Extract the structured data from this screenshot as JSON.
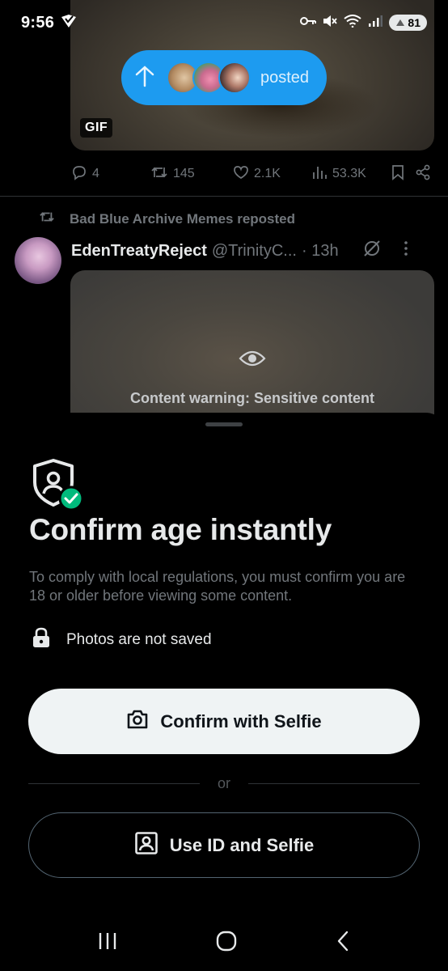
{
  "status_bar": {
    "time": "9:56",
    "battery": "81",
    "icons": [
      "location-check-icon",
      "key-icon",
      "mute-icon",
      "wifi-icon",
      "signal-icon",
      "battery-icon"
    ]
  },
  "previous_post": {
    "media_badge": "GIF",
    "new_posts_pill": {
      "label": "posted",
      "icon": "arrow-up-icon"
    },
    "actions": {
      "replies": "4",
      "reposts": "145",
      "likes": "2.1K",
      "views": "53.3K"
    }
  },
  "tweet": {
    "repost_context": "Bad Blue Archive Memes reposted",
    "author_name": "EdenTreatyReject",
    "author_handle": "@TrinityC...",
    "time": "· 13h",
    "content_warning": "Content warning: Sensitive content"
  },
  "sheet": {
    "title": "Confirm age instantly",
    "description": "To comply with local regulations, you must confirm you are 18 or older before viewing some content.",
    "privacy_note": "Photos are not saved",
    "primary_button": "Confirm with Selfie",
    "separator": "or",
    "secondary_button": "Use ID and Selfie"
  },
  "colors": {
    "accent": "#1d9bf0",
    "success": "#00ba7c",
    "muted": "#71767b",
    "background": "#000000"
  }
}
